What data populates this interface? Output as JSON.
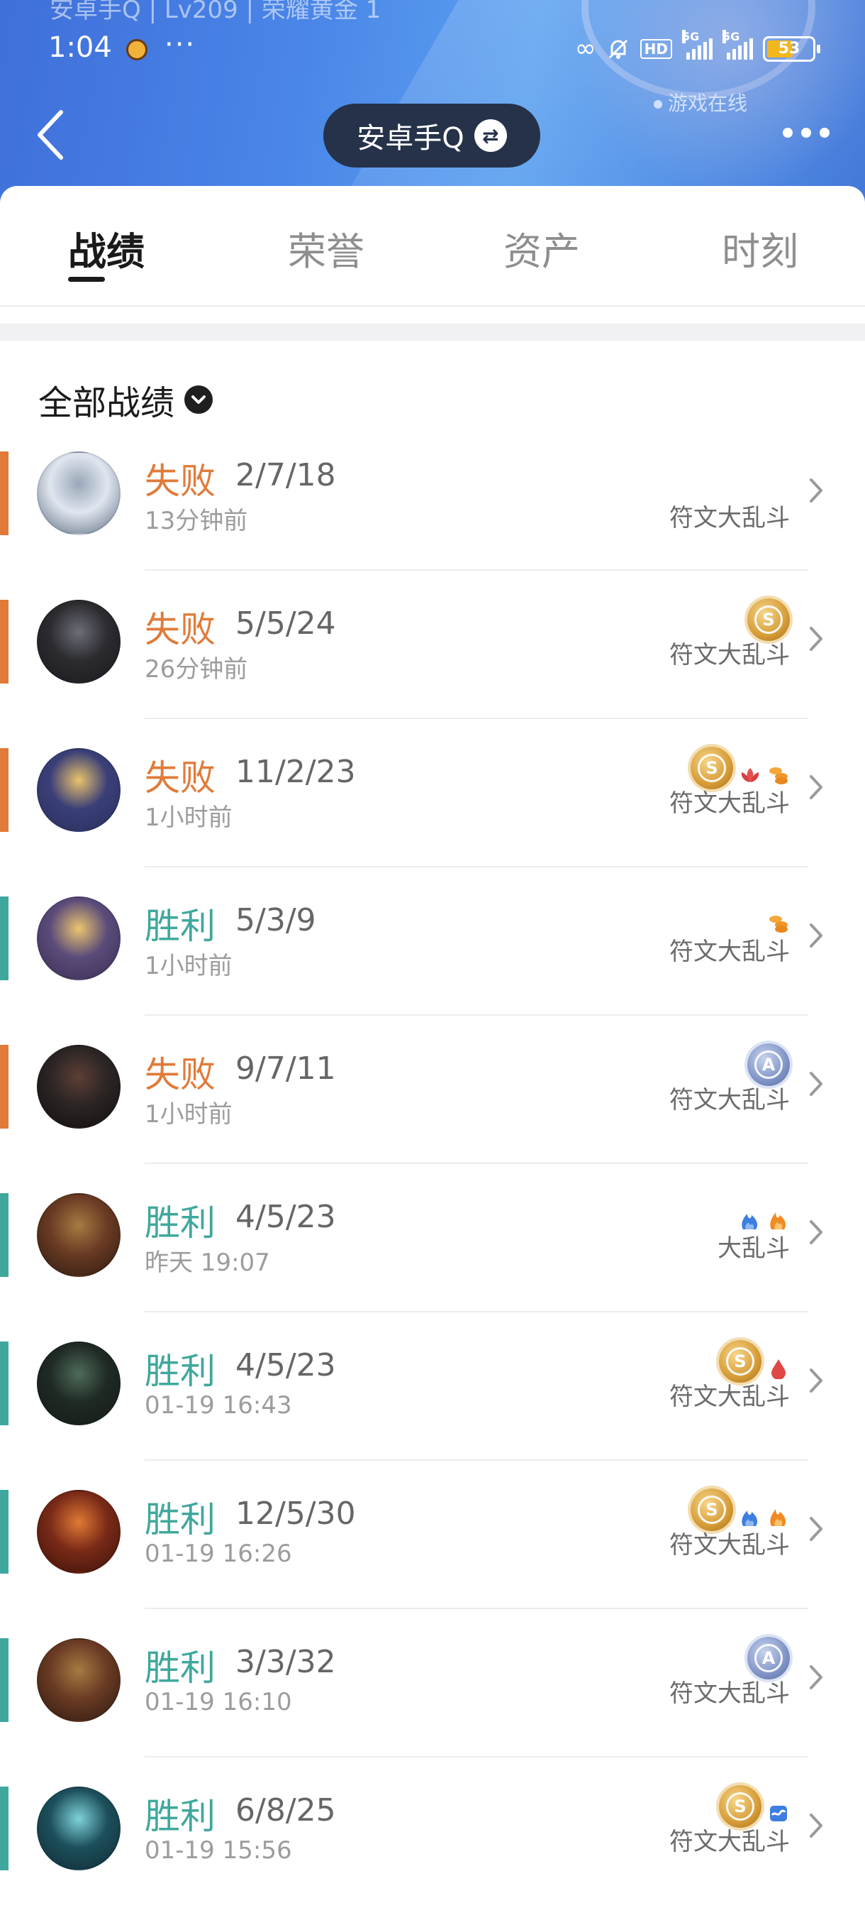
{
  "header": {
    "faded_top_text": "安卓手Q | Lv209 | 荣耀黄金 1",
    "status_time": "1:04",
    "status_dots": "···",
    "battery": "53",
    "hd_label": "HD",
    "signal_label": "5G",
    "title": "安卓手Q",
    "online_text": "游戏在线"
  },
  "tabs": [
    {
      "label": "战绩",
      "active": true
    },
    {
      "label": "荣誉",
      "active": false
    },
    {
      "label": "资产",
      "active": false
    },
    {
      "label": "时刻",
      "active": false
    }
  ],
  "filter": {
    "label": "全部战绩"
  },
  "colors": {
    "loss": "#e07b3a",
    "win": "#3fa89c"
  },
  "matches": [
    {
      "result": "失败",
      "kda": "2/7/18",
      "time": "13分钟前",
      "mode": "符文大乱斗",
      "outcome": "loss",
      "badges": []
    },
    {
      "result": "失败",
      "kda": "5/5/24",
      "time": "26分钟前",
      "mode": "符文大乱斗",
      "outcome": "loss",
      "badges": [
        "medal-s"
      ]
    },
    {
      "result": "失败",
      "kda": "11/2/23",
      "time": "1小时前",
      "mode": "符文大乱斗",
      "outcome": "loss",
      "badges": [
        "medal-s",
        "lotus",
        "coins"
      ]
    },
    {
      "result": "胜利",
      "kda": "5/3/9",
      "time": "1小时前",
      "mode": "符文大乱斗",
      "outcome": "win",
      "badges": [
        "coins"
      ]
    },
    {
      "result": "失败",
      "kda": "9/7/11",
      "time": "1小时前",
      "mode": "符文大乱斗",
      "outcome": "loss",
      "badges": [
        "medal-a"
      ]
    },
    {
      "result": "胜利",
      "kda": "4/5/23",
      "time": "昨天 19:07",
      "mode": "大乱斗",
      "outcome": "win",
      "badges": [
        "blue-flame",
        "orange-flame"
      ]
    },
    {
      "result": "胜利",
      "kda": "4/5/23",
      "time": "01-19 16:43",
      "mode": "符文大乱斗",
      "outcome": "win",
      "badges": [
        "medal-s",
        "blood-drop"
      ]
    },
    {
      "result": "胜利",
      "kda": "12/5/30",
      "time": "01-19 16:26",
      "mode": "符文大乱斗",
      "outcome": "win",
      "badges": [
        "medal-s",
        "blue-flame",
        "orange-flame"
      ]
    },
    {
      "result": "胜利",
      "kda": "3/3/32",
      "time": "01-19 16:10",
      "mode": "符文大乱斗",
      "outcome": "win",
      "badges": [
        "medal-a"
      ]
    },
    {
      "result": "胜利",
      "kda": "6/8/25",
      "time": "01-19 15:56",
      "mode": "符文大乱斗",
      "outcome": "win",
      "badges": [
        "medal-s",
        "wave-badge"
      ]
    }
  ]
}
